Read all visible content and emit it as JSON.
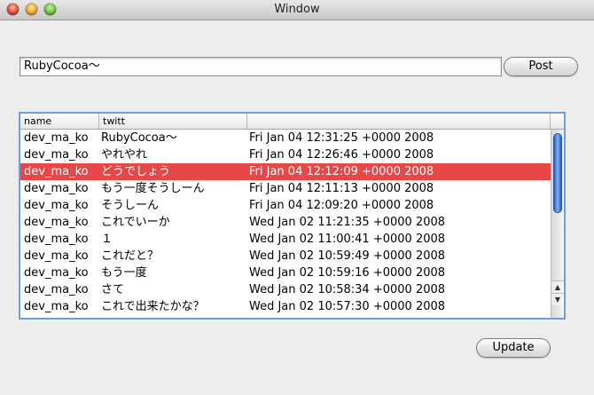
{
  "window": {
    "title": "Window"
  },
  "compose": {
    "value": "RubyCocoa〜",
    "post_label": "Post"
  },
  "table": {
    "columns": [
      "name",
      "twitt",
      ""
    ],
    "rows": [
      {
        "name": "dev_ma_ko",
        "twitt": "RubyCocoa〜",
        "date": "Fri Jan 04 12:31:25 +0000 2008"
      },
      {
        "name": "dev_ma_ko",
        "twitt": "やれやれ",
        "date": "Fri Jan 04 12:26:46 +0000 2008"
      },
      {
        "name": "dev_ma_ko",
        "twitt": "どうでしょう",
        "date": "Fri Jan 04 12:12:09 +0000 2008"
      },
      {
        "name": "dev_ma_ko",
        "twitt": "もう一度そうしーん",
        "date": "Fri Jan 04 12:11:13 +0000 2008"
      },
      {
        "name": "dev_ma_ko",
        "twitt": "そうしーん",
        "date": "Fri Jan 04 12:09:20 +0000 2008"
      },
      {
        "name": "dev_ma_ko",
        "twitt": "これでいーか",
        "date": "Wed Jan 02 11:21:35 +0000 2008"
      },
      {
        "name": "dev_ma_ko",
        "twitt": "１",
        "date": "Wed Jan 02 11:00:41 +0000 2008"
      },
      {
        "name": "dev_ma_ko",
        "twitt": "これだと？",
        "date": "Wed Jan 02 10:59:49 +0000 2008"
      },
      {
        "name": "dev_ma_ko",
        "twitt": "もう一度",
        "date": "Wed Jan 02 10:59:16 +0000 2008"
      },
      {
        "name": "dev_ma_ko",
        "twitt": "さて",
        "date": "Wed Jan 02 10:58:34 +0000 2008"
      },
      {
        "name": "dev_ma_ko",
        "twitt": "これで出来たかな？",
        "date": "Wed Jan 02 10:57:30 +0000 2008"
      }
    ],
    "selected_index": 2
  },
  "update_label": "Update",
  "icons": {
    "scroll_up": "▲",
    "scroll_down": "▼"
  },
  "colors": {
    "selection": "#e84747",
    "focus_ring": "#6e9fd8"
  }
}
